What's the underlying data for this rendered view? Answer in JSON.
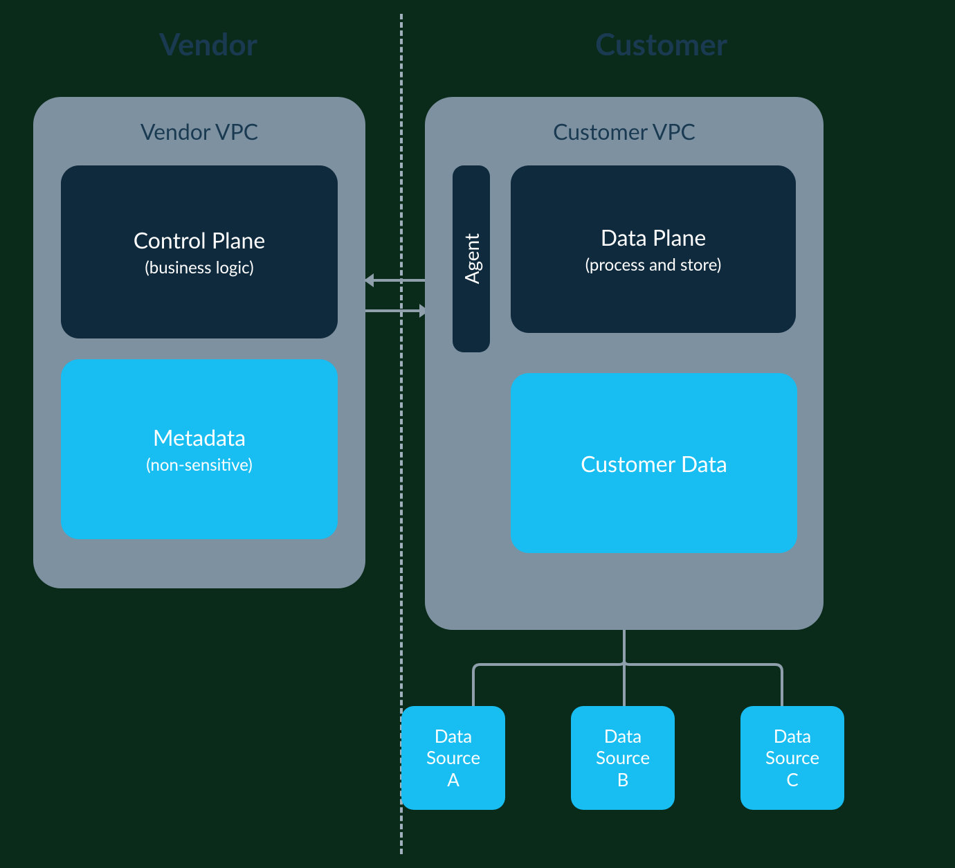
{
  "headings": {
    "vendor": "Vendor",
    "customer": "Customer"
  },
  "vendor_vpc": {
    "title": "Vendor VPC",
    "control_plane": {
      "title": "Control Plane",
      "sub": "(business logic)"
    },
    "metadata": {
      "title": "Metadata",
      "sub": "(non-sensitive)"
    }
  },
  "customer_vpc": {
    "title": "Customer VPC",
    "agent": "Agent",
    "data_plane": {
      "title": "Data Plane",
      "sub": "(process and store)"
    },
    "customer_data": {
      "title": "Customer Data"
    }
  },
  "data_sources": [
    {
      "line1": "Data",
      "line2": "Source",
      "line3": "A"
    },
    {
      "line1": "Data",
      "line2": "Source",
      "line3": "B"
    },
    {
      "line1": "Data",
      "line2": "Source",
      "line3": "C"
    }
  ]
}
